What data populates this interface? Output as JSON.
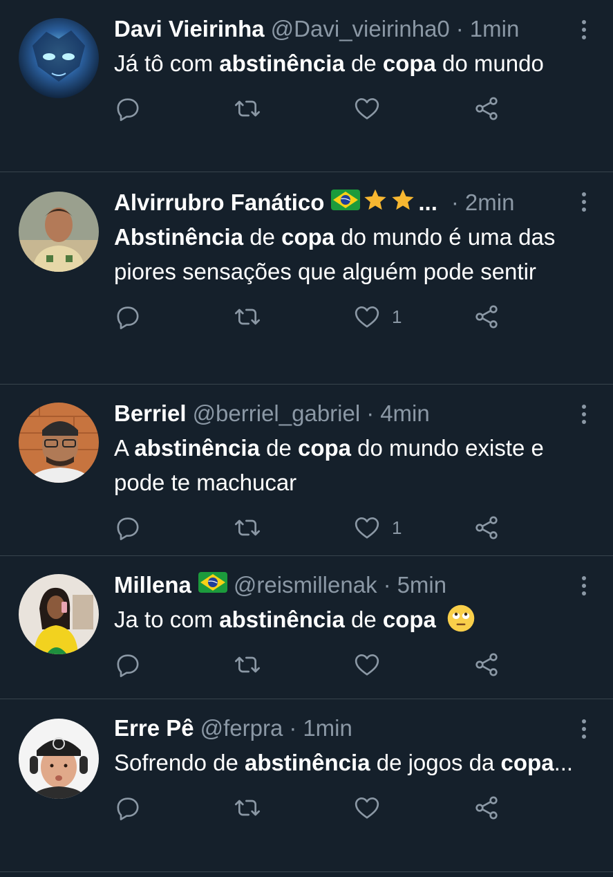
{
  "colors": {
    "background": "#15202b",
    "divider": "#38444d",
    "secondary_text": "#8b98a5",
    "primary_text": "#ffffff"
  },
  "tweets": [
    {
      "name": "Davi Vieirinha",
      "handle": "@Davi_vieirinha0",
      "separator": "·",
      "time": "1min",
      "badges": [],
      "text": [
        {
          "t": "Já tô com ",
          "b": false
        },
        {
          "t": "abstinência",
          "b": true
        },
        {
          "t": " de ",
          "b": false
        },
        {
          "t": "copa",
          "b": true
        },
        {
          "t": " do mundo",
          "b": false
        }
      ],
      "likes": ""
    },
    {
      "name": "Alvirrubro Fanático",
      "handle": "",
      "separator": "·",
      "time": "2min",
      "badges": [
        "brazil-flag",
        "star",
        "star"
      ],
      "name_ellipsis": "...",
      "text": [
        {
          "t": "Abstinência",
          "b": true
        },
        {
          "t": " de ",
          "b": false
        },
        {
          "t": "copa",
          "b": true
        },
        {
          "t": " do mundo é uma das piores sensações que alguém pode sentir",
          "b": false
        }
      ],
      "likes": "1"
    },
    {
      "name": "Berriel",
      "handle": "@berriel_gabriel",
      "separator": "·",
      "time": "4min",
      "badges": [],
      "text": [
        {
          "t": "A ",
          "b": false
        },
        {
          "t": "abstinência",
          "b": true
        },
        {
          "t": " de ",
          "b": false
        },
        {
          "t": "copa",
          "b": true
        },
        {
          "t": " do mundo existe e pode te machucar",
          "b": false
        }
      ],
      "likes": "1"
    },
    {
      "name": "Millena",
      "handle": "@reismillenak",
      "separator": "·",
      "time": "5min",
      "badges": [
        "brazil-flag"
      ],
      "text": [
        {
          "t": "Ja to com ",
          "b": false
        },
        {
          "t": "abstinência",
          "b": true
        },
        {
          "t": " de ",
          "b": false
        },
        {
          "t": "copa",
          "b": true
        }
      ],
      "trailing_emoji": "eye-roll-emoji",
      "likes": ""
    },
    {
      "name": "Erre Pê",
      "handle": "@ferpra",
      "separator": "·",
      "time": "1min",
      "badges": [],
      "text": [
        {
          "t": "Sofrendo de ",
          "b": false
        },
        {
          "t": "abstinência",
          "b": true
        },
        {
          "t": " de jogos da ",
          "b": false
        },
        {
          "t": "copa",
          "b": true
        },
        {
          "t": "...",
          "b": false
        }
      ],
      "likes": ""
    }
  ],
  "icons": {
    "reply": "reply-icon",
    "retweet": "retweet-icon",
    "like": "heart-icon",
    "share": "share-icon",
    "more": "more-options-icon"
  }
}
